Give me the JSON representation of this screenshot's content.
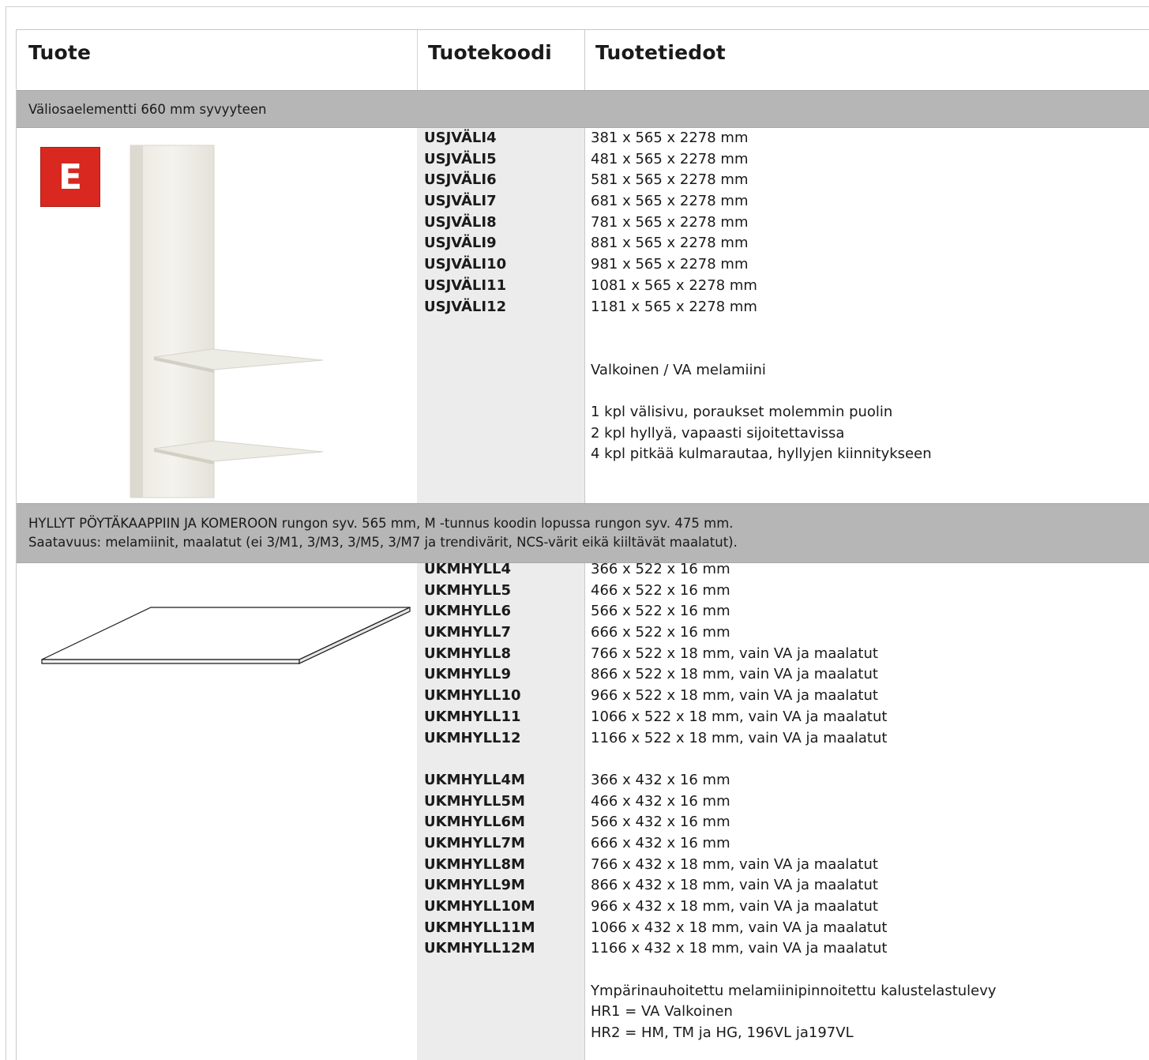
{
  "header": {
    "col1": "Tuote",
    "col2": "Tuotekoodi",
    "col3": "Tuotetiedot"
  },
  "section1": {
    "title": "Väliosaelementti 660 mm syvyyteen",
    "badge": "E",
    "codes": [
      "USJVÄLI4",
      "USJVÄLI5",
      "USJVÄLI6",
      "USJVÄLI7",
      "USJVÄLI8",
      "USJVÄLI9",
      "USJVÄLI10",
      "USJVÄLI11",
      "USJVÄLI12"
    ],
    "dims": [
      "381 x 565 x 2278 mm",
      "481 x 565 x 2278 mm",
      "581 x 565 x 2278 mm",
      "681 x 565 x 2278 mm",
      "781 x 565 x 2278 mm",
      "881 x 565 x 2278 mm",
      "981 x 565 x 2278 mm",
      "1081 x 565 x 2278 mm",
      "1181 x 565 x 2278 mm"
    ],
    "material": "Valkoinen / VA melamiini",
    "contents": [
      "1 kpl välisivu, poraukset molemmin puolin",
      "2 kpl hyllyä, vapaasti sijoitettavissa",
      "4 kpl pitkää kulmarautaa, hyllyjen kiinnitykseen"
    ]
  },
  "section2": {
    "title_line1": "HYLLYT  PÖYTÄKAAPPIIN JA KOMEROON  rungon syv. 565 mm,   M -tunnus koodin lopussa rungon syv. 475 mm.",
    "title_line2": "Saatavuus: melamiinit, maalatut (ei 3/M1, 3/M3, 3/M5, 3/M7 ja trendivärit, NCS-värit eikä kiiltävät maalatut).",
    "codes_a": [
      "UKMHYLL4",
      "UKMHYLL5",
      "UKMHYLL6",
      "UKMHYLL7",
      "UKMHYLL8",
      "UKMHYLL9",
      "UKMHYLL10",
      "UKMHYLL11",
      "UKMHYLL12"
    ],
    "dims_a": [
      "366 x 522 x 16 mm",
      "466 x 522 x 16 mm",
      "566 x 522 x 16 mm",
      "666 x 522 x 16 mm",
      "766 x 522 x 18 mm, vain VA ja maalatut",
      "866 x 522 x 18 mm, vain VA ja maalatut",
      "966 x 522 x 18 mm, vain VA ja maalatut",
      "1066 x 522 x 18 mm, vain VA ja maalatut",
      "1166 x 522 x 18 mm, vain VA ja maalatut"
    ],
    "codes_b": [
      "UKMHYLL4M",
      "UKMHYLL5M",
      "UKMHYLL6M",
      "UKMHYLL7M",
      "UKMHYLL8M",
      "UKMHYLL9M",
      "UKMHYLL10M",
      "UKMHYLL11M",
      "UKMHYLL12M"
    ],
    "dims_b": [
      "366 x 432 x 16 mm",
      "466 x 432 x 16 mm",
      "566 x 432 x 16 mm",
      "666 x 432 x 16 mm",
      "766 x 432 x 18 mm, vain VA ja maalatut",
      "866 x 432 x 18 mm, vain VA ja maalatut",
      "966 x 432 x 18 mm, vain VA ja maalatut",
      "1066 x 432 x 18 mm, vain VA ja maalatut",
      "1166 x 432 x 18 mm, vain VA ja maalatut"
    ],
    "notes": [
      "Ympärinauhoitettu melamiinipinnoitettu kalustelastulevy",
      "HR1 = VA Valkoinen",
      "HR2 = HM, TM ja HG, 196VL ja197VL"
    ]
  }
}
